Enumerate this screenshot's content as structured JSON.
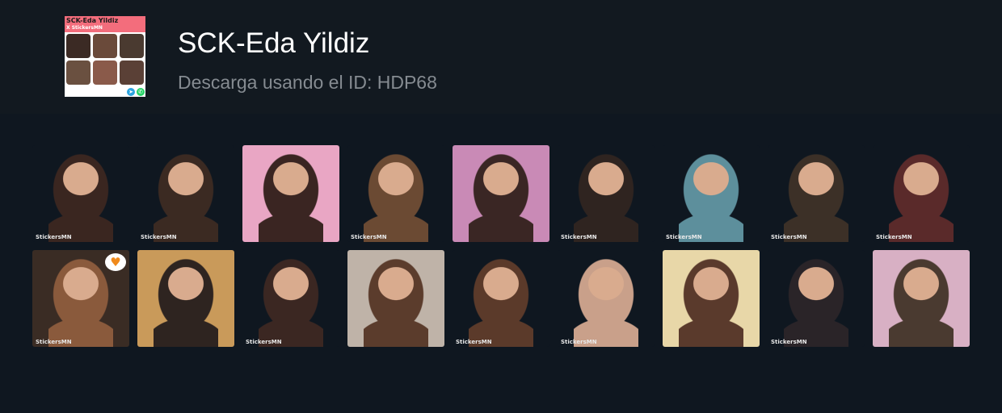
{
  "pack": {
    "title": "SCK-Eda Yildiz",
    "subtitle": "Descarga usando el ID: HDP68",
    "thumbnail": {
      "banner_title": "SCK-Eda Yildiz",
      "banner_subtitle": "X StickersMN",
      "icons": [
        "telegram-icon",
        "whatsapp-icon"
      ]
    }
  },
  "colors": {
    "page_background": "#0f1720",
    "header_background": "#121920",
    "title": "#ffffff",
    "subtitle": "#858b91",
    "banner": "#f36d7c"
  },
  "stickers": [
    {
      "id": "sticker-1",
      "watermark": "StickersMN",
      "bg": "#0f1720",
      "tone": "#3a2620"
    },
    {
      "id": "sticker-2",
      "watermark": "StickersMN",
      "bg": "#0f1720",
      "tone": "#3b2a22"
    },
    {
      "id": "sticker-3",
      "watermark": "",
      "bg": "#e9a6c4",
      "tone": "#3a2522"
    },
    {
      "id": "sticker-4",
      "watermark": "StickersMN",
      "bg": "#0f1720",
      "tone": "#6b4a33"
    },
    {
      "id": "sticker-5",
      "watermark": "",
      "bg": "#c98ab6",
      "tone": "#3a2624"
    },
    {
      "id": "sticker-6",
      "watermark": "StickersMN",
      "bg": "#0f1720",
      "tone": "#2f2420"
    },
    {
      "id": "sticker-7",
      "watermark": "StickersMN",
      "bg": "#0f1720",
      "tone": "#5d8f9c"
    },
    {
      "id": "sticker-8",
      "watermark": "StickersMN",
      "bg": "#0f1720",
      "tone": "#3c3027"
    },
    {
      "id": "sticker-9",
      "watermark": "StickersMN",
      "bg": "#0f1720",
      "tone": "#5a2a2a"
    },
    {
      "id": "sticker-10",
      "watermark": "StickersMN",
      "bg": "#3a2c24",
      "tone": "#8a5a3c",
      "badge": "heart-speech-bubble"
    },
    {
      "id": "sticker-11",
      "watermark": "",
      "bg": "#c99a5a",
      "tone": "#2e2420"
    },
    {
      "id": "sticker-12",
      "watermark": "StickersMN",
      "bg": "#0f1720",
      "tone": "#3b2722"
    },
    {
      "id": "sticker-13",
      "watermark": "",
      "bg": "#bfb3a8",
      "tone": "#5b3c2c"
    },
    {
      "id": "sticker-14",
      "watermark": "StickersMN",
      "bg": "#0f1720",
      "tone": "#5b3a2a"
    },
    {
      "id": "sticker-15",
      "watermark": "StickersMN",
      "bg": "#0f1720",
      "tone": "#c9a08a"
    },
    {
      "id": "sticker-16",
      "watermark": "",
      "bg": "#e8d7a8",
      "tone": "#5a3a2c"
    },
    {
      "id": "sticker-17",
      "watermark": "StickersMN",
      "bg": "#0f1720",
      "tone": "#2a2428"
    },
    {
      "id": "sticker-18",
      "watermark": "",
      "bg": "#d8b0c4",
      "tone": "#4a3a30"
    }
  ]
}
